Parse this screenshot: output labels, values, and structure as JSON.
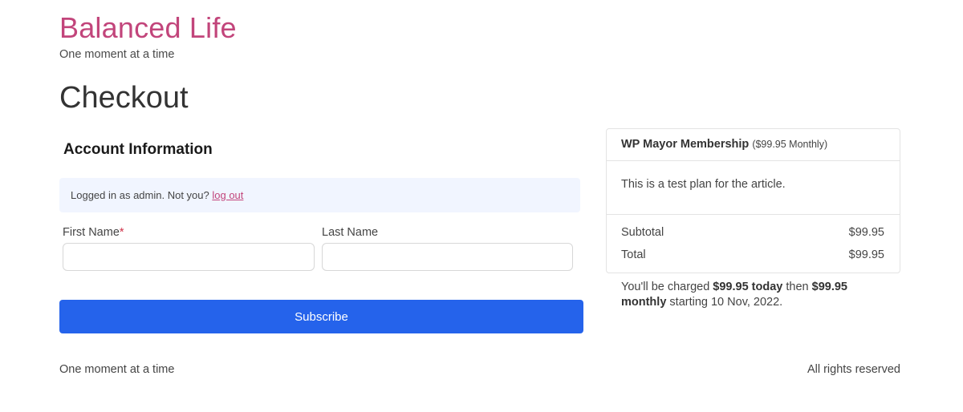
{
  "header": {
    "site_title": "Balanced Life",
    "tagline": "One moment at a time"
  },
  "page": {
    "title": "Checkout"
  },
  "account": {
    "section_title": "Account Information",
    "logged_in_text": "Logged in as admin. Not you?",
    "logout_link": "log out",
    "first_name_label": "First Name",
    "required_mark": "*",
    "first_name_value": "",
    "last_name_label": "Last Name",
    "last_name_value": "",
    "subscribe_label": "Subscribe"
  },
  "summary": {
    "plan_name": "WP Mayor Membership",
    "plan_price_note": "($99.95 Monthly)",
    "description": "This is a test plan for the article.",
    "subtotal_label": "Subtotal",
    "subtotal_value": "$99.95",
    "total_label": "Total",
    "total_value": "$99.95"
  },
  "charge_note": {
    "prefix": "You'll be charged ",
    "today_amount": "$99.95 today",
    "middle": " then ",
    "recurring_amount": "$99.95 monthly",
    "suffix": " starting 10 Nov, 2022."
  },
  "footer": {
    "left_text": "One moment at a time",
    "right_text": "All rights reserved"
  },
  "colors": {
    "brand": "#c2457b",
    "button": "#2563eb",
    "notice_bg": "#f1f5ff"
  }
}
